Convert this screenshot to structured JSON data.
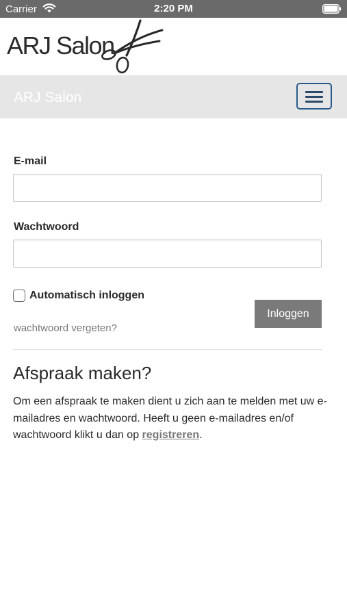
{
  "status_bar": {
    "carrier": "Carrier",
    "time": "2:20 PM",
    "wifi_icon": "wifi-icon",
    "battery_icon": "battery-icon"
  },
  "logo": {
    "text": "ARJ Salon",
    "icon": "scissors-icon"
  },
  "navbar": {
    "brand": "ARJ Salon",
    "menu_icon": "hamburger-icon",
    "brand_color": "#ffffff",
    "background": "#e6e6e6",
    "toggle_border_color": "#2a5a8a"
  },
  "form": {
    "email_label": "E-mail",
    "email_value": "",
    "password_label": "Wachtwoord",
    "password_value": "",
    "remember_label": "Automatisch inloggen",
    "remember_checked": false,
    "login_button": "Inloggen",
    "login_button_color": "#7a7a7a",
    "forgot_link": "wachtwoord vergeten?"
  },
  "appointment": {
    "title": "Afspraak maken?",
    "text_before": "Om een afspraak te maken dient u zich aan te melden met uw e-mailadres en wachtwoord. Heeft u geen e-mailadres en/of wachtwoord klikt u dan op ",
    "link": "registreren",
    "text_after": "."
  }
}
